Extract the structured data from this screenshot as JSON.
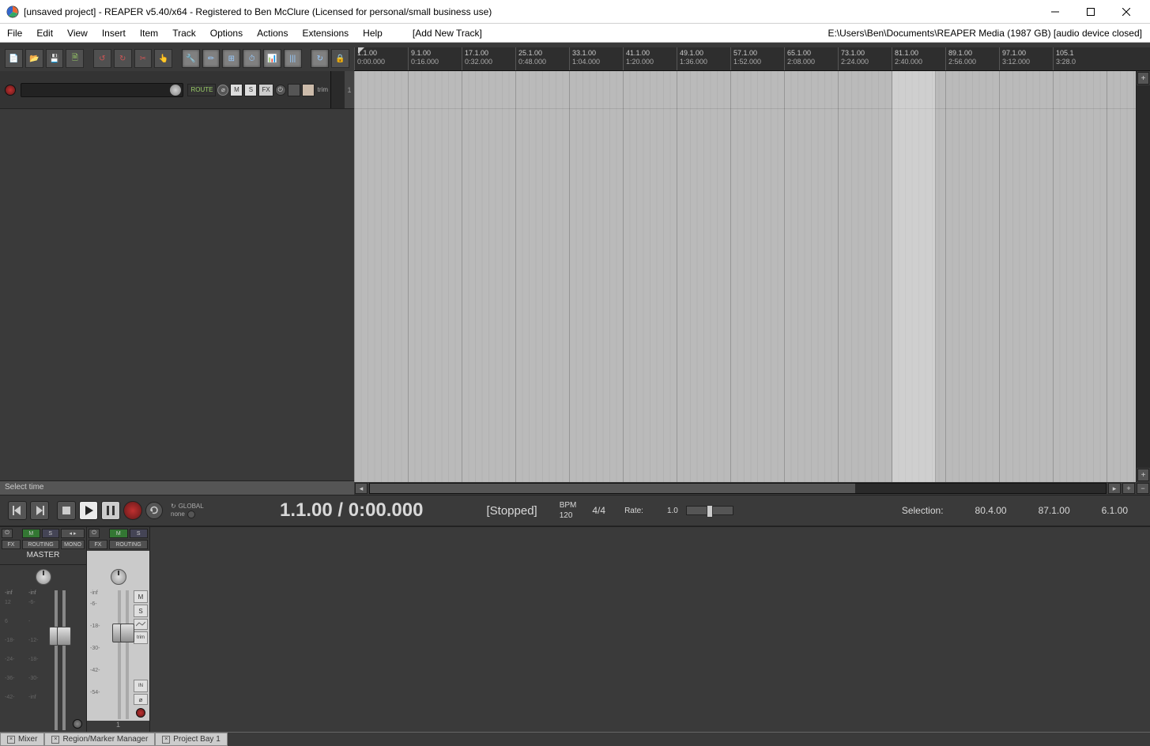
{
  "title": "[unsaved project] - REAPER v5.40/x64 - Registered to Ben McClure (Licensed for personal/small business use)",
  "menu": [
    "File",
    "Edit",
    "View",
    "Insert",
    "Item",
    "Track",
    "Options",
    "Actions",
    "Extensions",
    "Help"
  ],
  "addNewTrack": "[Add New Track]",
  "statusRight": "E:\\Users\\Ben\\Documents\\REAPER Media (1987 GB) [audio device closed]",
  "toolbarActiveIndices": [
    8,
    9,
    10,
    11,
    12,
    13,
    14
  ],
  "ruler": [
    {
      "b": "1.1.00",
      "t": "0:00.000"
    },
    {
      "b": "9.1.00",
      "t": "0:16.000"
    },
    {
      "b": "17.1.00",
      "t": "0:32.000"
    },
    {
      "b": "25.1.00",
      "t": "0:48.000"
    },
    {
      "b": "33.1.00",
      "t": "1:04.000"
    },
    {
      "b": "41.1.00",
      "t": "1:20.000"
    },
    {
      "b": "49.1.00",
      "t": "1:36.000"
    },
    {
      "b": "57.1.00",
      "t": "1:52.000"
    },
    {
      "b": "65.1.00",
      "t": "2:08.000"
    },
    {
      "b": "73.1.00",
      "t": "2:24.000"
    },
    {
      "b": "81.1.00",
      "t": "2:40.000"
    },
    {
      "b": "89.1.00",
      "t": "2:56.000"
    },
    {
      "b": "97.1.00",
      "t": "3:12.000"
    },
    {
      "b": "105.1",
      "t": "3:28.0"
    }
  ],
  "track": {
    "num": "1",
    "route": "ROUTE",
    "m": "M",
    "s": "S",
    "fx": "FX",
    "trim": "trim"
  },
  "selectTime": "Select time",
  "transport": {
    "global": "GLOBAL",
    "none": "none",
    "time": "1.1.00 / 0:00.000",
    "status": "[Stopped]",
    "bpmLabel": "BPM",
    "bpm": "120",
    "timesig": "4/4",
    "rateLabel": "Rate:",
    "rate": "1.0",
    "selLabel": "Selection:",
    "selStart": "80.4.00",
    "selEnd": "87.1.00",
    "selLen": "6.1.00"
  },
  "mixer": {
    "master": {
      "fx": "FX",
      "m": "M",
      "s": "S",
      "routing": "ROUTING",
      "mono": "MONO",
      "label": "MASTER",
      "inf": "-inf",
      "ticks": [
        "12",
        "-6-",
        "6",
        "-",
        "-18-",
        "-12-",
        "-24-",
        "-18-",
        "-36-",
        "-30-",
        "-42-",
        "-inf"
      ]
    },
    "track": {
      "fx": "FX",
      "m": "M",
      "s": "S",
      "routing": "ROUTING",
      "num": "1",
      "inf": "-inf",
      "trim": "trim",
      "in": "IN",
      "ticks": [
        "-6-",
        "-18-",
        "-30-",
        "-42-",
        "-54-"
      ]
    }
  },
  "tabs": [
    "Mixer",
    "Region/Marker Manager",
    "Project Bay 1"
  ]
}
